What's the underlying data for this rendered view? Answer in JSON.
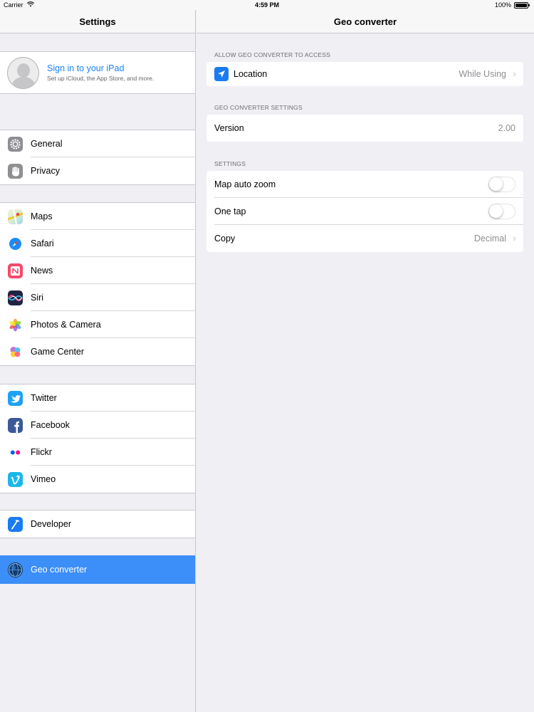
{
  "status_bar": {
    "carrier": "Carrier",
    "time": "4:59 PM",
    "battery": "100%"
  },
  "sidebar": {
    "title": "Settings",
    "profile": {
      "title": "Sign in to your iPad",
      "subtitle": "Set up iCloud, the App Store, and more."
    },
    "items": [
      {
        "label": "General",
        "icon": "gear-icon",
        "color": "#8e8e93"
      },
      {
        "label": "Privacy",
        "icon": "hand-icon",
        "color": "#8e8e93"
      },
      {
        "label": "Maps",
        "icon": "maps-icon",
        "color": "#5ac864"
      },
      {
        "label": "Safari",
        "icon": "compass-icon",
        "color": "#1b8cf5"
      },
      {
        "label": "News",
        "icon": "news-icon",
        "color": "#f24a6a"
      },
      {
        "label": "Siri",
        "icon": "siri-icon",
        "color": "#2b2f48"
      },
      {
        "label": "Photos & Camera",
        "icon": "photos-icon",
        "color": "#ffffff"
      },
      {
        "label": "Game Center",
        "icon": "game-center-icon",
        "color": "#ffffff"
      },
      {
        "label": "Twitter",
        "icon": "twitter-icon",
        "color": "#1da1f2"
      },
      {
        "label": "Facebook",
        "icon": "facebook-icon",
        "color": "#3b5998"
      },
      {
        "label": "Flickr",
        "icon": "flickr-icon",
        "color": "#ffffff"
      },
      {
        "label": "Vimeo",
        "icon": "vimeo-icon",
        "color": "#1ab7ea"
      },
      {
        "label": "Developer",
        "icon": "developer-icon",
        "color": "#1a7bf2"
      },
      {
        "label": "Geo converter",
        "icon": "globe-icon",
        "color": "#0a2b55",
        "selected": true
      }
    ]
  },
  "detail": {
    "title": "Geo converter",
    "access_header": "ALLOW GEO CONVERTER TO ACCESS",
    "location": {
      "label": "Location",
      "value": "While Using"
    },
    "settings_header_1": "GEO CONVERTER SETTINGS",
    "version": {
      "label": "Version",
      "value": "2.00"
    },
    "settings_header_2": "SETTINGS",
    "map_auto_zoom": {
      "label": "Map auto zoom",
      "on": false
    },
    "one_tap": {
      "label": "One tap",
      "on": false
    },
    "copy": {
      "label": "Copy",
      "value": "Decimal"
    }
  },
  "colors": {
    "accent": "#1a82fb",
    "selection": "#3c8ef8"
  }
}
